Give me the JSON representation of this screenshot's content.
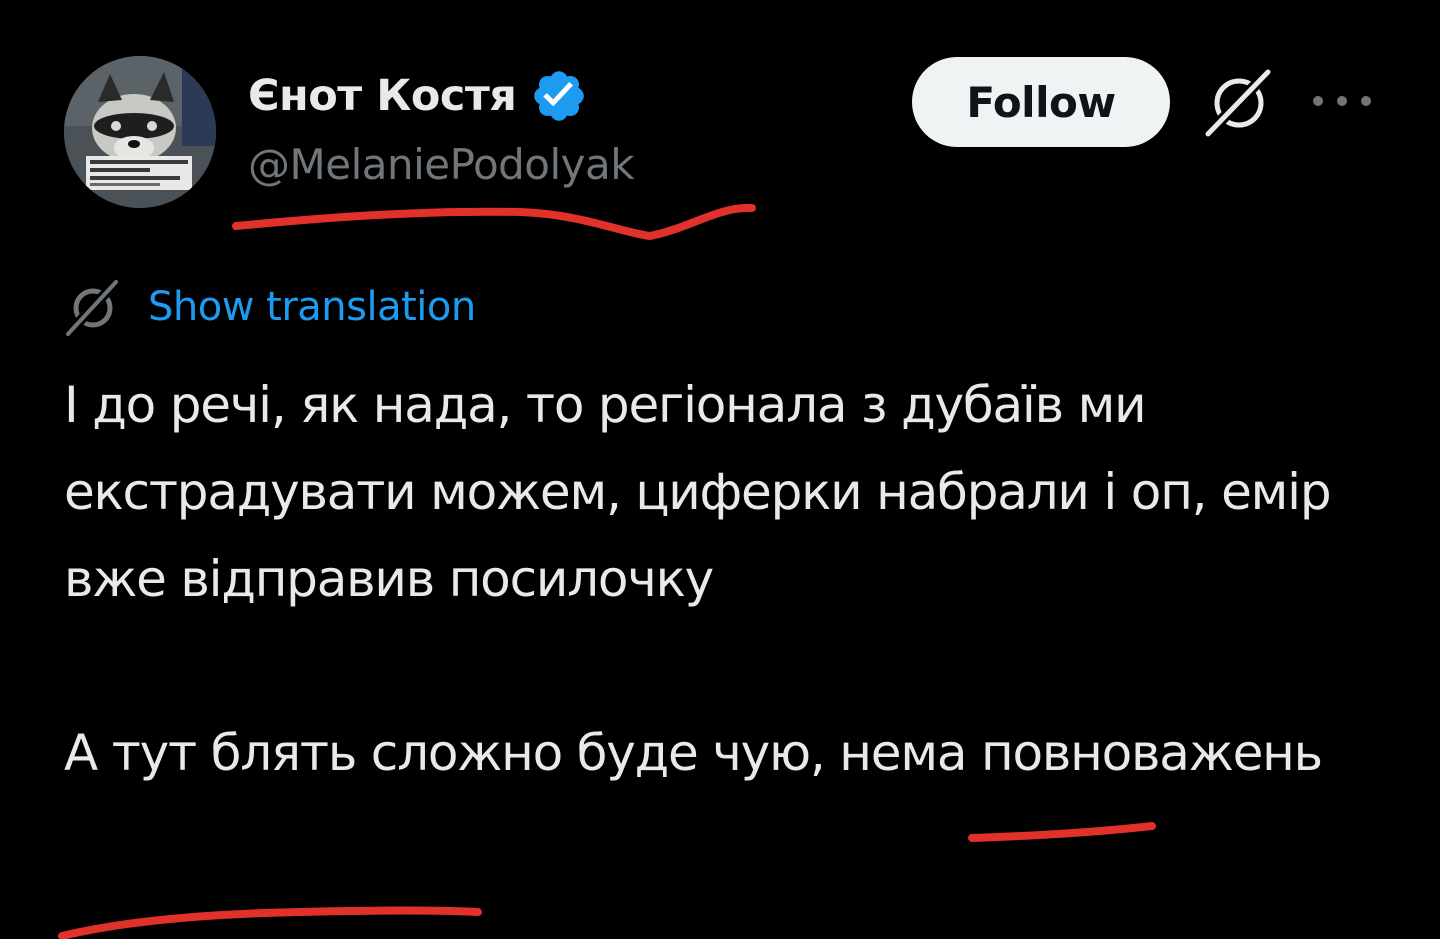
{
  "user": {
    "display_name": "Єнот Костя",
    "handle": "@MelaniePodolyak",
    "verified": true,
    "avatar_icon": "raccoon-avatar"
  },
  "actions": {
    "follow_label": "Follow",
    "grok_icon": "grok-icon",
    "more_icon": "more-options-icon"
  },
  "translation": {
    "icon": "translate-icon",
    "label": "Show translation"
  },
  "tweet": {
    "paragraphs": [
      "І до речі, як нада, то регіонала з дубаїв ми екстрадувати можем, циферки набрали і оп, емір вже відправив посилочку",
      "А тут блять сложно буде чую, нема повноважень"
    ]
  },
  "colors": {
    "background": "#000000",
    "text_primary": "#e7e9ea",
    "text_secondary": "#71767b",
    "link": "#1d9bf0",
    "verified_badge": "#1d9bf0",
    "follow_button_bg": "#eff3f4",
    "annotation_ink": "#e0312b"
  }
}
